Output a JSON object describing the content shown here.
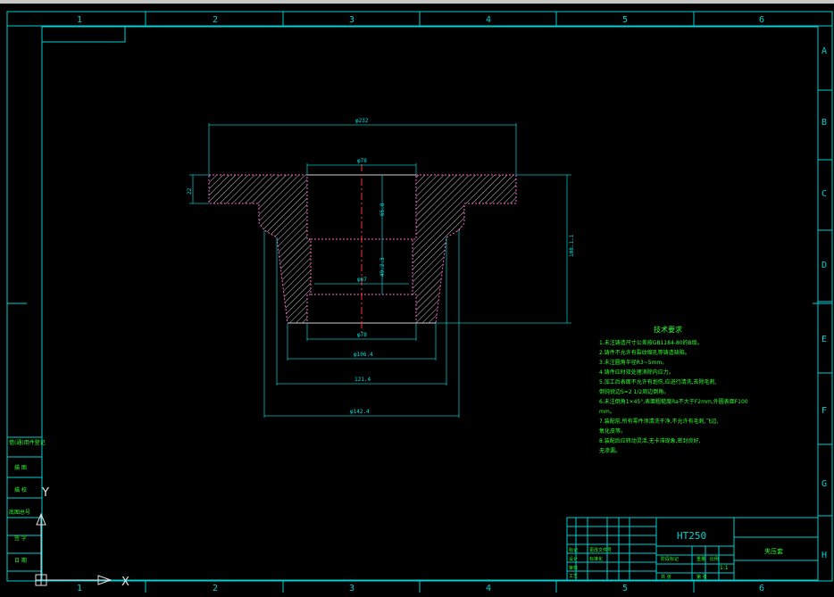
{
  "border": {
    "columns_top": [
      "1",
      "2",
      "3",
      "4",
      "5",
      "6"
    ],
    "columns_bottom": [
      "1",
      "2",
      "3",
      "4",
      "5",
      "6"
    ],
    "rows_right": [
      "A",
      "B",
      "C",
      "D",
      "E",
      "F",
      "G",
      "H"
    ]
  },
  "dimensions": {
    "d_outer": "φ232",
    "d_bore_top": "φ78",
    "depth_top": "65.8",
    "flange_thk": "22",
    "d_mid": "φ67",
    "depth_mid": "49.2.3",
    "d_bottom_bore": "φ78",
    "d_106": "φ106.4",
    "d_121": "121.4",
    "d_142": "φ142.4",
    "height_total": "108.1.1"
  },
  "tech": {
    "title": "技术要求",
    "lines": [
      "1.未注铸造尺寸公差按GB1184-80的B级。",
      "2.铸件不允许有裂纹缩孔等铸造缺陷。",
      "3.未注圆角半径R3~5mm。",
      "4.铸件应时效处理消除内应力。",
      "5.加工后表面不允许有划伤,应进行清洗,去除毛刺,",
      "倒钝锐边S=2 1/2周边倒角。",
      "6.未注倒角1×45°,表面粗糙度Ra不大于F2mm,外圆表面F100",
      "mm。",
      "7.装配前,所有零件须清洗干净,不允许有毛刺,飞边,",
      "氧化皮等。",
      "8.装配后应转动灵活,无卡滞现象,密封良好,",
      "无渗漏。"
    ]
  },
  "titleblock": {
    "material": "HT250",
    "part_name": "夹压套",
    "scale": "1:1",
    "cells": [
      "标记",
      "处数",
      "分区",
      "更改文件号",
      "签名",
      "年月日",
      "设计",
      "标准化",
      "阶段标记",
      "重量",
      "比例",
      "审核",
      "工艺",
      "批准",
      "共 张",
      "第 张"
    ]
  },
  "sidebar_left": {
    "items": [
      "借(通)用件登记",
      "旧底图总号",
      "描 图",
      "描 校",
      "底图总号",
      "签 字",
      "日 期"
    ]
  },
  "ucs": {
    "x_label": "X",
    "y_label": "Y"
  }
}
